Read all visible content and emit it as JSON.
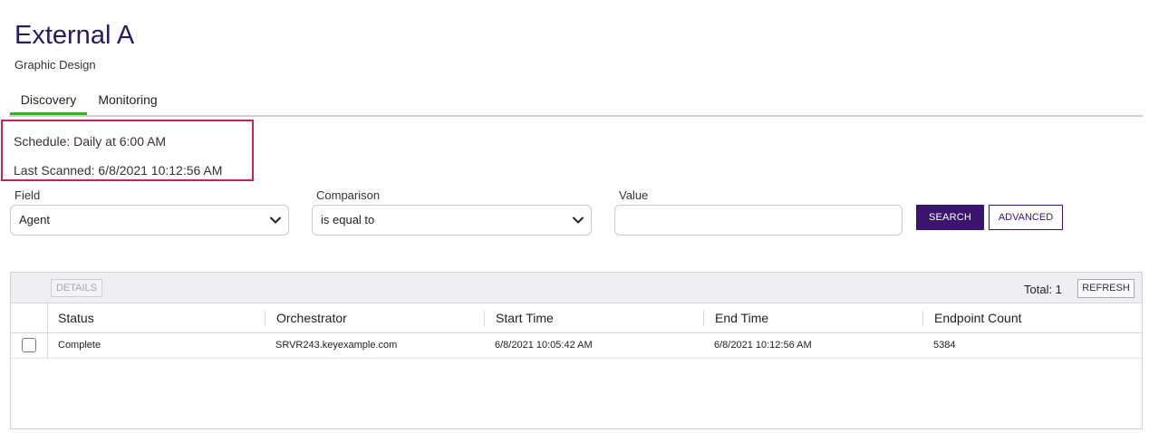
{
  "page": {
    "title": "External A",
    "subtitle": "Graphic Design"
  },
  "tabs": [
    {
      "label": "Discovery",
      "active": true
    },
    {
      "label": "Monitoring",
      "active": false
    }
  ],
  "info": {
    "schedule": "Schedule: Daily at 6:00 AM",
    "last_scanned": "Last Scanned: 6/8/2021 10:12:56 AM"
  },
  "filters": {
    "field_label": "Field",
    "field_value": "Agent",
    "comparison_label": "Comparison",
    "comparison_value": "is equal to",
    "value_label": "Value",
    "value_value": "",
    "search_label": "SEARCH",
    "advanced_label": "ADVANCED"
  },
  "grid": {
    "details_label": "DETAILS",
    "total_label": "Total: 1",
    "refresh_label": "REFRESH",
    "columns": [
      "Status",
      "Orchestrator",
      "Start Time",
      "End Time",
      "Endpoint Count"
    ],
    "rows": [
      {
        "status": "Complete",
        "orchestrator": "SRVR243.keyexample.com",
        "start_time": "6/8/2021 10:05:42 AM",
        "end_time": "6/8/2021 10:12:56 AM",
        "endpoint_count": "5384",
        "checked": false
      }
    ]
  },
  "colors": {
    "title": "#2b1a5c",
    "primary_button": "#3b1470",
    "active_tab": "#3dae2b",
    "highlight_border": "#c8244e"
  },
  "icons": {
    "dropdown": "chevron-down-icon",
    "row_select": "checkbox"
  }
}
